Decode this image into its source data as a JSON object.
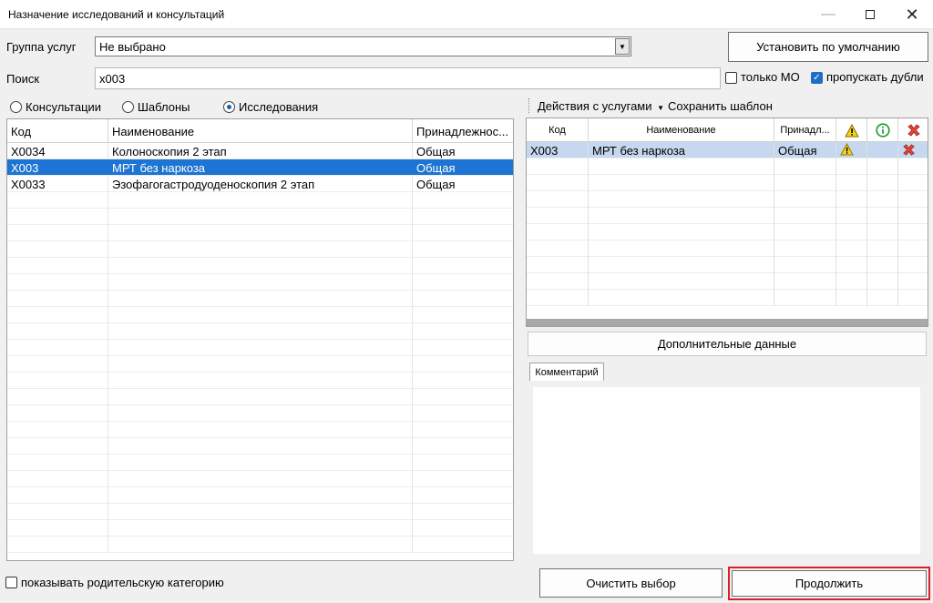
{
  "window": {
    "title": "Назначение исследований и консультаций"
  },
  "filters": {
    "group_label": "Группа услуг",
    "group_value": "Не выбрано",
    "default_button": "Установить по умолчанию",
    "search_label": "Поиск",
    "search_value": "x003",
    "only_mo_label": "только МО",
    "only_mo_checked": false,
    "skip_dupes_label": "пропускать дубли",
    "skip_dupes_checked": true
  },
  "mode_options": [
    {
      "label": "Консультации",
      "selected": false
    },
    {
      "label": "Шаблоны",
      "selected": false
    },
    {
      "label": "Исследования",
      "selected": true
    }
  ],
  "services_table": {
    "columns": [
      "Код",
      "Наименование",
      "Принадлежнос..."
    ],
    "rows": [
      {
        "code": "X0034",
        "name": "Колоноскопия 2 этап",
        "owner": "Общая",
        "selected": false
      },
      {
        "code": "X003",
        "name": "МРТ без наркоза",
        "owner": "Общая",
        "selected": true
      },
      {
        "code": "X0033",
        "name": "Эзофагогастродуоденоскопия 2 этап",
        "owner": "Общая",
        "selected": false
      }
    ]
  },
  "right_toolbar": {
    "actions_label": "Действия с услугами",
    "save_template_label": "Сохранить шаблон"
  },
  "selected_table": {
    "columns": [
      "Код",
      "Наименование",
      "Принадл..."
    ],
    "icon_columns": [
      "warning-icon",
      "info-icon",
      "delete-icon"
    ],
    "rows": [
      {
        "code": "X003",
        "name": "МРТ без наркоза",
        "owner": "Общая"
      }
    ]
  },
  "extra_data_button": "Дополнительные данные",
  "comment_tab": "Комментарий",
  "show_parent_label": "показывать родительскую категорию",
  "show_parent_checked": false,
  "clear_button": "Очистить выбор",
  "continue_button": "Продолжить",
  "colors": {
    "selection": "#1e74d2",
    "accent": "#1f6dc5",
    "highlight_border": "#d8212e"
  }
}
